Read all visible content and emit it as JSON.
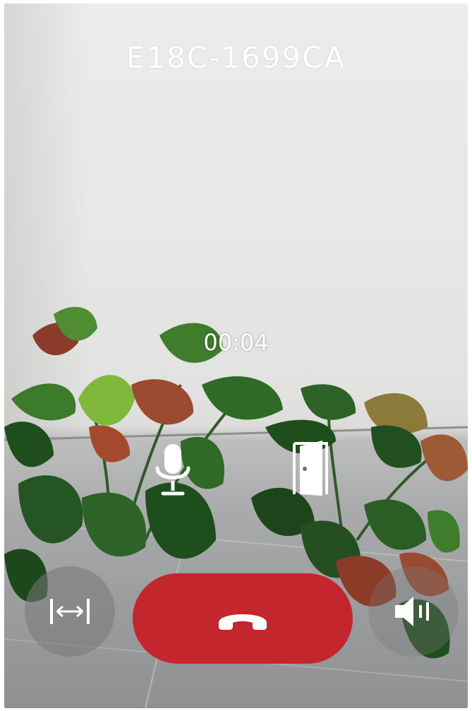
{
  "call": {
    "device_id": "E18C-1699CA",
    "duration": "00:04"
  },
  "controls": {
    "microphone": {
      "icon": "microphone-icon"
    },
    "unlock_door": {
      "icon": "door-icon"
    },
    "fit_screen": {
      "icon": "fit-width-icon"
    },
    "hang_up": {
      "icon": "phone-hangup-icon",
      "color": "#c4262e"
    },
    "speaker": {
      "icon": "speaker-icon"
    }
  }
}
